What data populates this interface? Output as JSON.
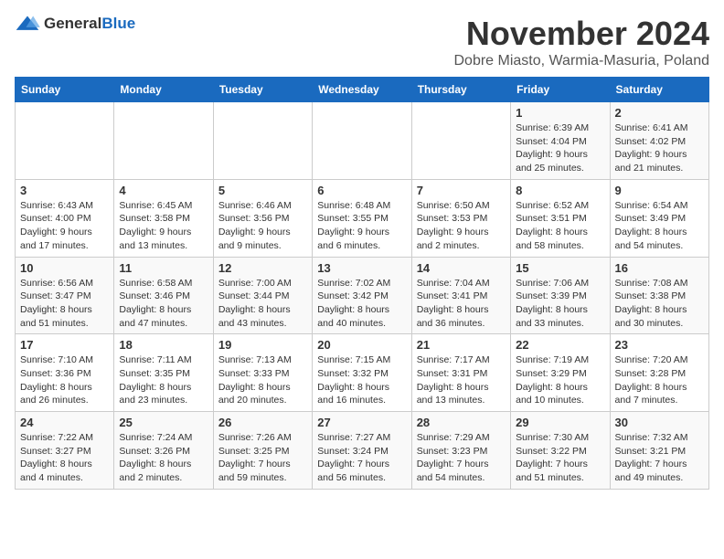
{
  "logo": {
    "text_general": "General",
    "text_blue": "Blue"
  },
  "title": {
    "month": "November 2024",
    "location": "Dobre Miasto, Warmia-Masuria, Poland"
  },
  "headers": [
    "Sunday",
    "Monday",
    "Tuesday",
    "Wednesday",
    "Thursday",
    "Friday",
    "Saturday"
  ],
  "weeks": [
    [
      {
        "day": "",
        "info": ""
      },
      {
        "day": "",
        "info": ""
      },
      {
        "day": "",
        "info": ""
      },
      {
        "day": "",
        "info": ""
      },
      {
        "day": "",
        "info": ""
      },
      {
        "day": "1",
        "info": "Sunrise: 6:39 AM\nSunset: 4:04 PM\nDaylight: 9 hours and 25 minutes."
      },
      {
        "day": "2",
        "info": "Sunrise: 6:41 AM\nSunset: 4:02 PM\nDaylight: 9 hours and 21 minutes."
      }
    ],
    [
      {
        "day": "3",
        "info": "Sunrise: 6:43 AM\nSunset: 4:00 PM\nDaylight: 9 hours and 17 minutes."
      },
      {
        "day": "4",
        "info": "Sunrise: 6:45 AM\nSunset: 3:58 PM\nDaylight: 9 hours and 13 minutes."
      },
      {
        "day": "5",
        "info": "Sunrise: 6:46 AM\nSunset: 3:56 PM\nDaylight: 9 hours and 9 minutes."
      },
      {
        "day": "6",
        "info": "Sunrise: 6:48 AM\nSunset: 3:55 PM\nDaylight: 9 hours and 6 minutes."
      },
      {
        "day": "7",
        "info": "Sunrise: 6:50 AM\nSunset: 3:53 PM\nDaylight: 9 hours and 2 minutes."
      },
      {
        "day": "8",
        "info": "Sunrise: 6:52 AM\nSunset: 3:51 PM\nDaylight: 8 hours and 58 minutes."
      },
      {
        "day": "9",
        "info": "Sunrise: 6:54 AM\nSunset: 3:49 PM\nDaylight: 8 hours and 54 minutes."
      }
    ],
    [
      {
        "day": "10",
        "info": "Sunrise: 6:56 AM\nSunset: 3:47 PM\nDaylight: 8 hours and 51 minutes."
      },
      {
        "day": "11",
        "info": "Sunrise: 6:58 AM\nSunset: 3:46 PM\nDaylight: 8 hours and 47 minutes."
      },
      {
        "day": "12",
        "info": "Sunrise: 7:00 AM\nSunset: 3:44 PM\nDaylight: 8 hours and 43 minutes."
      },
      {
        "day": "13",
        "info": "Sunrise: 7:02 AM\nSunset: 3:42 PM\nDaylight: 8 hours and 40 minutes."
      },
      {
        "day": "14",
        "info": "Sunrise: 7:04 AM\nSunset: 3:41 PM\nDaylight: 8 hours and 36 minutes."
      },
      {
        "day": "15",
        "info": "Sunrise: 7:06 AM\nSunset: 3:39 PM\nDaylight: 8 hours and 33 minutes."
      },
      {
        "day": "16",
        "info": "Sunrise: 7:08 AM\nSunset: 3:38 PM\nDaylight: 8 hours and 30 minutes."
      }
    ],
    [
      {
        "day": "17",
        "info": "Sunrise: 7:10 AM\nSunset: 3:36 PM\nDaylight: 8 hours and 26 minutes."
      },
      {
        "day": "18",
        "info": "Sunrise: 7:11 AM\nSunset: 3:35 PM\nDaylight: 8 hours and 23 minutes."
      },
      {
        "day": "19",
        "info": "Sunrise: 7:13 AM\nSunset: 3:33 PM\nDaylight: 8 hours and 20 minutes."
      },
      {
        "day": "20",
        "info": "Sunrise: 7:15 AM\nSunset: 3:32 PM\nDaylight: 8 hours and 16 minutes."
      },
      {
        "day": "21",
        "info": "Sunrise: 7:17 AM\nSunset: 3:31 PM\nDaylight: 8 hours and 13 minutes."
      },
      {
        "day": "22",
        "info": "Sunrise: 7:19 AM\nSunset: 3:29 PM\nDaylight: 8 hours and 10 minutes."
      },
      {
        "day": "23",
        "info": "Sunrise: 7:20 AM\nSunset: 3:28 PM\nDaylight: 8 hours and 7 minutes."
      }
    ],
    [
      {
        "day": "24",
        "info": "Sunrise: 7:22 AM\nSunset: 3:27 PM\nDaylight: 8 hours and 4 minutes."
      },
      {
        "day": "25",
        "info": "Sunrise: 7:24 AM\nSunset: 3:26 PM\nDaylight: 8 hours and 2 minutes."
      },
      {
        "day": "26",
        "info": "Sunrise: 7:26 AM\nSunset: 3:25 PM\nDaylight: 7 hours and 59 minutes."
      },
      {
        "day": "27",
        "info": "Sunrise: 7:27 AM\nSunset: 3:24 PM\nDaylight: 7 hours and 56 minutes."
      },
      {
        "day": "28",
        "info": "Sunrise: 7:29 AM\nSunset: 3:23 PM\nDaylight: 7 hours and 54 minutes."
      },
      {
        "day": "29",
        "info": "Sunrise: 7:30 AM\nSunset: 3:22 PM\nDaylight: 7 hours and 51 minutes."
      },
      {
        "day": "30",
        "info": "Sunrise: 7:32 AM\nSunset: 3:21 PM\nDaylight: 7 hours and 49 minutes."
      }
    ]
  ]
}
